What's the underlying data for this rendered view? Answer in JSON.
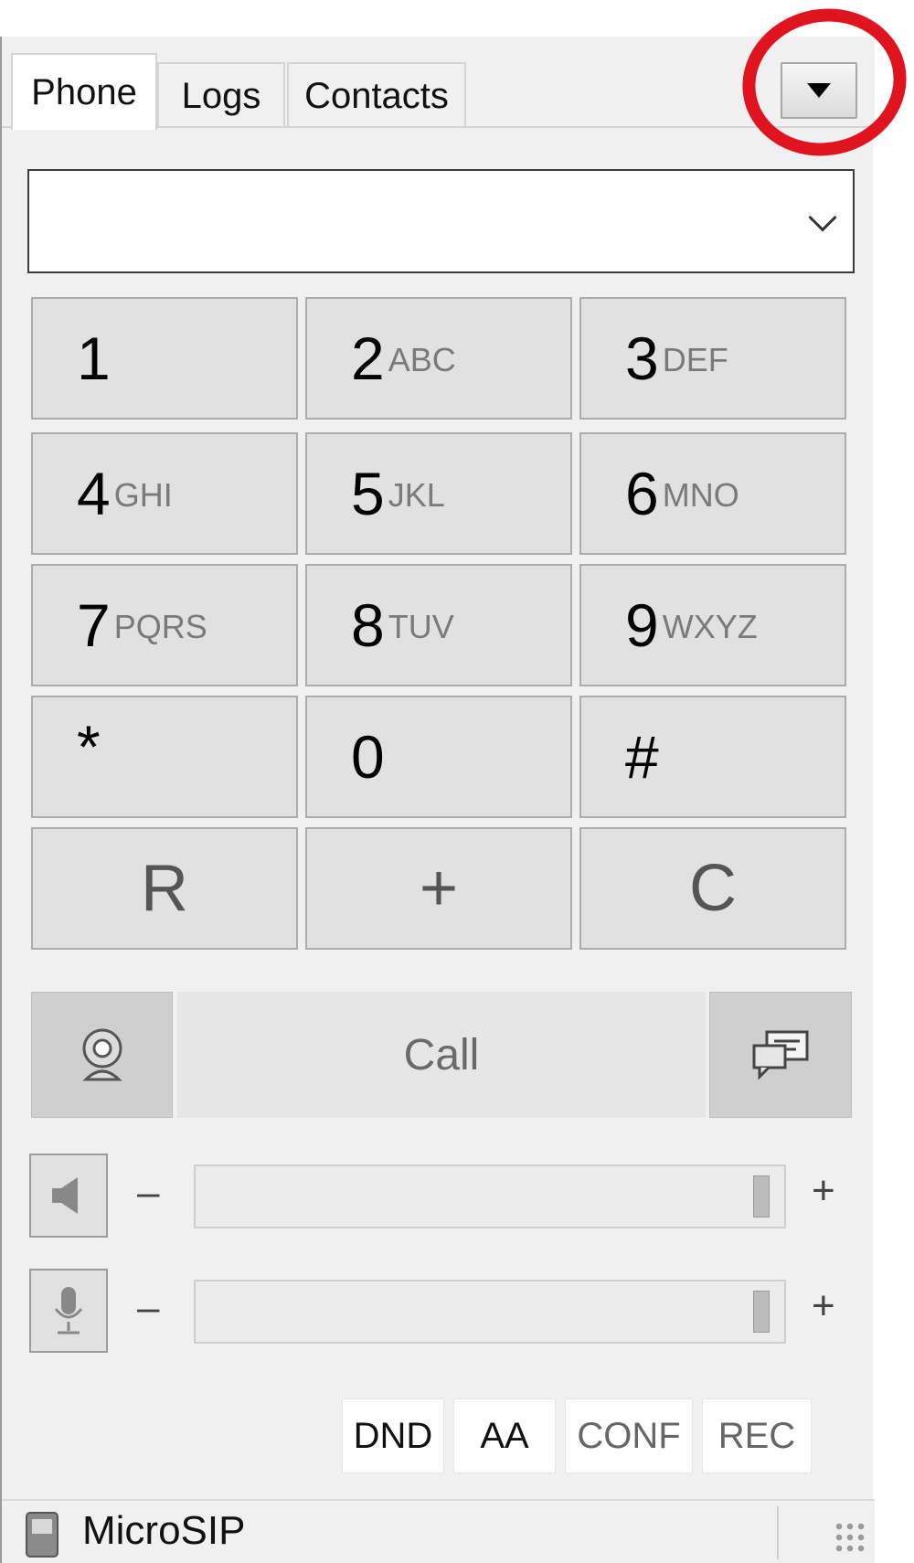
{
  "tabs": [
    {
      "label": "Phone",
      "active": true
    },
    {
      "label": "Logs",
      "active": false
    },
    {
      "label": "Contacts",
      "active": false
    }
  ],
  "menu_button": {
    "icon": "triangle-down-icon"
  },
  "number_input": {
    "value": "",
    "dropdown_icon": "chevron-down-icon"
  },
  "keypad": [
    {
      "digit": "1",
      "letters": ""
    },
    {
      "digit": "2",
      "letters": "ABC"
    },
    {
      "digit": "3",
      "letters": "DEF"
    },
    {
      "digit": "4",
      "letters": "GHI"
    },
    {
      "digit": "5",
      "letters": "JKL"
    },
    {
      "digit": "6",
      "letters": "MNO"
    },
    {
      "digit": "7",
      "letters": "PQRS"
    },
    {
      "digit": "8",
      "letters": "TUV"
    },
    {
      "digit": "9",
      "letters": "WXYZ"
    },
    {
      "digit": "*",
      "letters": ""
    },
    {
      "digit": "0",
      "letters": ""
    },
    {
      "digit": "#",
      "letters": ""
    },
    {
      "digit": "R",
      "letters": ""
    },
    {
      "digit": "+",
      "letters": ""
    },
    {
      "digit": "C",
      "letters": ""
    }
  ],
  "call": {
    "label": "Call",
    "video_icon": "webcam-icon",
    "message_icon": "chat-icon"
  },
  "speaker": {
    "icon": "speaker-icon",
    "minus": "–",
    "plus": "+",
    "level": 0.98
  },
  "microphone": {
    "icon": "microphone-icon",
    "minus": "–",
    "plus": "+",
    "level": 0.98
  },
  "toggles": [
    "DND",
    "AA",
    "CONF",
    "REC"
  ],
  "status": {
    "text": "MicroSIP",
    "icon": "phone-device-icon"
  },
  "colors": {
    "annotation": "#e0141e",
    "window_bg": "#f0f0f0",
    "key_bg": "#e1e1e1"
  }
}
